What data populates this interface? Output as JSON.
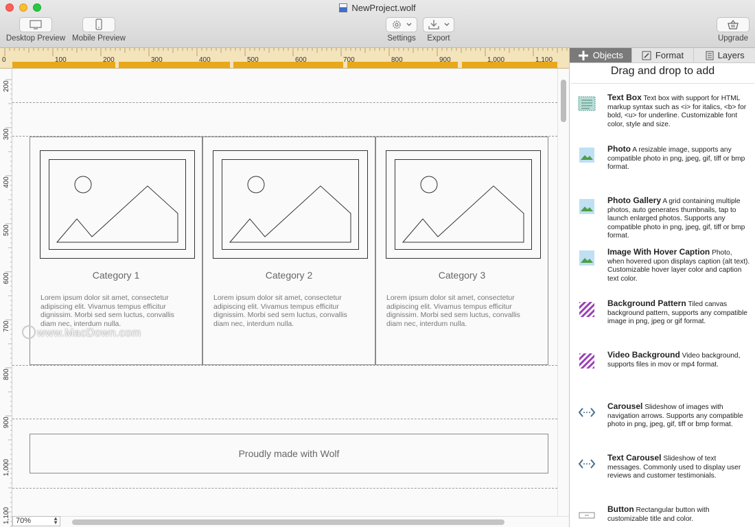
{
  "window": {
    "title": "NewProject.wolf"
  },
  "toolbar": {
    "desktop_preview": "Desktop Preview",
    "mobile_preview": "Mobile Preview",
    "settings": "Settings",
    "export": "Export",
    "upgrade": "Upgrade"
  },
  "ruler": {
    "h_ticks": [
      "0",
      "100",
      "200",
      "300",
      "400",
      "500",
      "600",
      "700",
      "800",
      "900",
      "1,000",
      "1,100"
    ],
    "v_ticks": [
      "200",
      "300",
      "400",
      "500",
      "600",
      "700",
      "800",
      "900",
      "1,000",
      "1,100"
    ]
  },
  "canvas": {
    "columns": [
      {
        "title": "Category 1",
        "body": "Lorem ipsum dolor sit amet, consectetur adipiscing elit. Vivamus tempus efficitur dignissim. Morbi sed sem luctus, convallis diam nec, interdum nulla."
      },
      {
        "title": "Category 2",
        "body": "Lorem ipsum dolor sit amet, consectetur adipiscing elit. Vivamus tempus efficitur dignissim. Morbi sed sem luctus, convallis diam nec, interdum nulla."
      },
      {
        "title": "Category 3",
        "body": "Lorem ipsum dolor sit amet, consectetur adipiscing elit. Vivamus tempus efficitur dignissim. Morbi sed sem luctus, convallis diam nec, interdum nulla."
      }
    ],
    "footer": "Proudly made with Wolf",
    "watermark": "www.MacDown.com"
  },
  "zoom": "70%",
  "panel": {
    "tabs": [
      "Objects",
      "Format",
      "Layers"
    ],
    "drag_title": "Drag and drop to add",
    "items": [
      {
        "name": "Text Box",
        "desc": "Text box with support for HTML markup syntax such as <i> for italics, <b> for bold, <u> for underline. Customizable font color, style and size.",
        "icon": "text-box-icon"
      },
      {
        "name": "Photo",
        "desc": "A resizable image, supports any compatible photo in png, jpeg, gif, tiff or bmp format.",
        "icon": "photo-icon"
      },
      {
        "name": "Photo Gallery",
        "desc": "A grid containing multiple photos, auto generates thumbnails, tap to launch enlarged photos. Supports any compatible photo in png, jpeg, gif, tiff or bmp format.",
        "icon": "photo-gallery-icon"
      },
      {
        "name": "Image With Hover Caption",
        "desc": "Photo, when hovered upon displays caption (alt text). Customizable hover layer color and caption text color.",
        "icon": "hover-caption-icon"
      },
      {
        "name": "Background Pattern",
        "desc": "Tiled canvas background pattern, supports any compatible image in png, jpeg or gif format.",
        "icon": "background-pattern-icon"
      },
      {
        "name": "Video Background",
        "desc": "Video background, supports files in mov or mp4 format.",
        "icon": "video-background-icon"
      },
      {
        "name": "Carousel",
        "desc": "Slideshow of images with navigation arrows.  Supports any compatible photo in png, jpeg, gif, tiff or bmp format.",
        "icon": "carousel-icon"
      },
      {
        "name": "Text Carousel",
        "desc": "Slideshow of text messages.  Commonly used to display user reviews and customer testimonials.",
        "icon": "text-carousel-icon"
      },
      {
        "name": "Button",
        "desc": "Rectangular button with customizable title and color.",
        "icon": "button-icon"
      }
    ]
  },
  "colors": {
    "ruler_bg": "#f4e4bc",
    "header_bar": "#e8a818",
    "active_tab": "#7a7a7a",
    "photo_icon": "#5a9c4a",
    "pattern_icon": "#9b3fb5"
  }
}
